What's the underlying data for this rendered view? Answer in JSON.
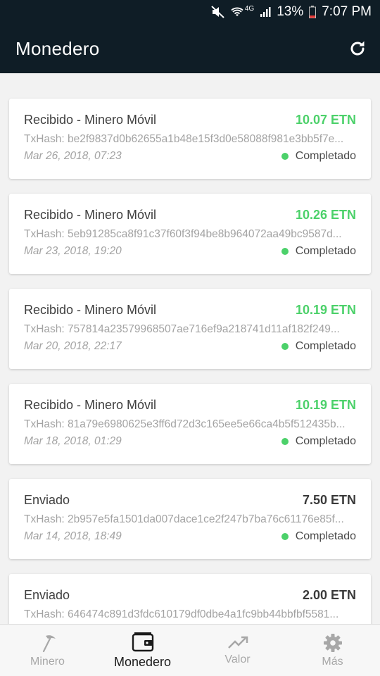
{
  "status_bar": {
    "network": "4G",
    "battery": "13%",
    "time": "7:07 PM"
  },
  "header": {
    "title": "Monedero"
  },
  "transactions": [
    {
      "title": "Recibido - Minero Móvil",
      "amount": "10.07 ETN",
      "type": "received",
      "hash": "TxHash: be2f9837d0b62655a1b48e15f3d0e58088f981e3bb5f7e...",
      "date": "Mar 26, 2018, 07:23",
      "status": "Completado"
    },
    {
      "title": "Recibido - Minero Móvil",
      "amount": "10.26 ETN",
      "type": "received",
      "hash": "TxHash: 5eb91285ca8f91c37f60f3f94be8b964072aa49bc9587d...",
      "date": "Mar 23, 2018, 19:20",
      "status": "Completado"
    },
    {
      "title": "Recibido - Minero Móvil",
      "amount": "10.19 ETN",
      "type": "received",
      "hash": "TxHash: 757814a23579968507ae716ef9a218741d11af182f249...",
      "date": "Mar 20, 2018, 22:17",
      "status": "Completado"
    },
    {
      "title": "Recibido - Minero Móvil",
      "amount": "10.19 ETN",
      "type": "received",
      "hash": "TxHash: 81a79e6980625e3ff6d72d3c165ee5e66ca4b5f512435b...",
      "date": "Mar 18, 2018, 01:29",
      "status": "Completado"
    },
    {
      "title": "Enviado",
      "amount": "7.50 ETN",
      "type": "sent",
      "hash": "TxHash: 2b957e5fa1501da007dace1ce2f247b7ba76c61176e85f...",
      "date": "Mar 14, 2018, 18:49",
      "status": "Completado"
    },
    {
      "title": "Enviado",
      "amount": "2.00 ETN",
      "type": "sent",
      "hash": "TxHash: 646474c891d3fdc610179df0dbe4a1fc9bb44bbfbf5581...",
      "date": "",
      "status": ""
    }
  ],
  "nav": {
    "items": [
      {
        "label": "Minero",
        "icon": "pickaxe-icon"
      },
      {
        "label": "Monedero",
        "icon": "wallet-icon",
        "active": true
      },
      {
        "label": "Valor",
        "icon": "trending-up-icon"
      },
      {
        "label": "Más",
        "icon": "gear-icon"
      }
    ]
  },
  "colors": {
    "header_bg": "#0f1d26",
    "received_amount": "#4cd16a",
    "status_dot": "#4cd16a",
    "page_bg": "#f2f2f2"
  }
}
